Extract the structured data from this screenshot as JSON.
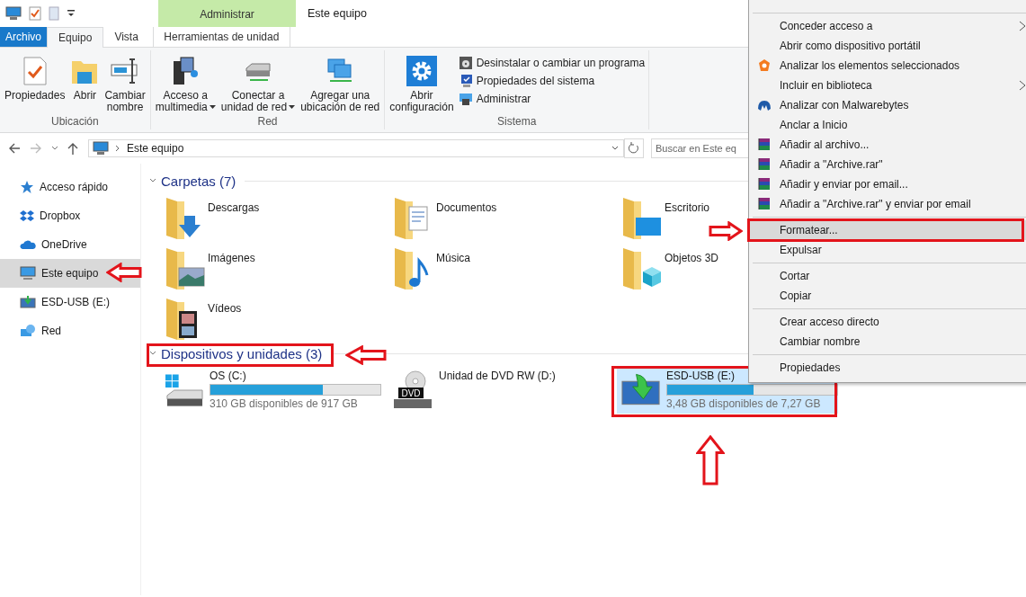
{
  "window": {
    "title": "Este equipo"
  },
  "context_tab": {
    "group": "Administrar",
    "label": "Herramientas de unidad",
    "selected": false
  },
  "ribbon_tabs": [
    {
      "label": "Archivo",
      "kind": "file",
      "selected": false
    },
    {
      "label": "Equipo",
      "kind": "tab",
      "selected": true
    },
    {
      "label": "Vista",
      "kind": "tab",
      "selected": false
    }
  ],
  "ribbon_groups": [
    {
      "name": "Ubicación",
      "buttons": [
        {
          "lines": [
            "Propiedades"
          ],
          "dropdown": false
        },
        {
          "lines": [
            "Abrir"
          ],
          "dropdown": false
        },
        {
          "lines": [
            "Cambiar",
            "nombre"
          ],
          "dropdown": false
        }
      ]
    },
    {
      "name": "Red",
      "buttons": [
        {
          "lines": [
            "Acceso a",
            "multimedia"
          ],
          "dropdown": true
        },
        {
          "lines": [
            "Conectar a",
            "unidad de red"
          ],
          "dropdown": true
        },
        {
          "lines": [
            "Agregar una",
            "ubicación de red"
          ],
          "dropdown": false
        }
      ]
    },
    {
      "name": "Sistema",
      "buttons": [
        {
          "lines": [
            "Abrir",
            "configuración"
          ],
          "dropdown": false
        }
      ],
      "small_buttons": [
        "Desinstalar o cambiar un programa",
        "Propiedades del sistema",
        "Administrar"
      ]
    }
  ],
  "address": {
    "path": "Este equipo",
    "search_placeholder": "Buscar en Este eq"
  },
  "sidebar": {
    "items": [
      {
        "label": "Acceso rápido",
        "selected": false
      },
      {
        "label": "Dropbox",
        "selected": false
      },
      {
        "label": "OneDrive",
        "selected": false
      },
      {
        "label": "Este equipo",
        "selected": true
      },
      {
        "label": "ESD-USB (E:)",
        "selected": false
      },
      {
        "label": "Red",
        "selected": false
      }
    ]
  },
  "folders": {
    "title": "Carpetas (7)",
    "expanded": true,
    "items": [
      {
        "name": "Descargas"
      },
      {
        "name": "Documentos"
      },
      {
        "name": "Escritorio"
      },
      {
        "name": "Imágenes"
      },
      {
        "name": "Música"
      },
      {
        "name": "Objetos 3D"
      },
      {
        "name": "Vídeos"
      }
    ]
  },
  "drives": {
    "title": "Dispositivos y unidades (3)",
    "expanded": true,
    "items": [
      {
        "name": "OS (C:)",
        "kind": "disk",
        "level": 0.66,
        "free": "310 GB disponibles de 917 GB",
        "selected": false
      },
      {
        "name": "Unidad de DVD RW (D:)",
        "kind": "dvd",
        "icon_label": "DVD",
        "selected": false
      },
      {
        "name": "ESD-USB (E:)",
        "kind": "usb",
        "level": 0.51,
        "free": "3,48 GB disponibles de 7,27 GB",
        "selected": true
      }
    ]
  },
  "context_menu": {
    "groups": [
      [
        {
          "label": "Conceder acceso a",
          "submenu": true,
          "selected": false
        },
        {
          "label": "Abrir como dispositivo portátil",
          "submenu": false,
          "selected": false
        },
        {
          "label": "Analizar los elementos seleccionados",
          "submenu": false,
          "selected": false
        },
        {
          "label": "Incluir en biblioteca",
          "submenu": true,
          "selected": false
        },
        {
          "label": "Analizar con Malwarebytes",
          "submenu": false,
          "selected": false
        },
        {
          "label": "Anclar a Inicio",
          "submenu": false,
          "selected": false
        },
        {
          "label": "Añadir al archivo...",
          "submenu": false,
          "selected": false
        },
        {
          "label": "Añadir a \"Archive.rar\"",
          "submenu": false,
          "selected": false
        },
        {
          "label": "Añadir y enviar por email...",
          "submenu": false,
          "selected": false
        },
        {
          "label": "Añadir a \"Archive.rar\" y enviar por email",
          "submenu": false,
          "selected": false
        }
      ],
      [
        {
          "label": "Formatear...",
          "submenu": false,
          "selected": true
        },
        {
          "label": "Expulsar",
          "submenu": false,
          "selected": false
        }
      ],
      [
        {
          "label": "Cortar",
          "submenu": false,
          "selected": false
        },
        {
          "label": "Copiar",
          "submenu": false,
          "selected": false
        }
      ],
      [
        {
          "label": "Crear acceso directo",
          "submenu": false,
          "selected": false
        },
        {
          "label": "Cambiar nombre",
          "submenu": false,
          "selected": false
        }
      ],
      [
        {
          "label": "Propiedades",
          "submenu": false,
          "selected": false
        }
      ]
    ]
  },
  "annotations": [
    {
      "kind": "leftarrow"
    },
    {
      "kind": "leftarrow"
    },
    {
      "kind": "rightarrow"
    },
    {
      "kind": "uparrow"
    },
    {
      "kind": "frame"
    },
    {
      "kind": "frame"
    },
    {
      "kind": "frame"
    }
  ]
}
